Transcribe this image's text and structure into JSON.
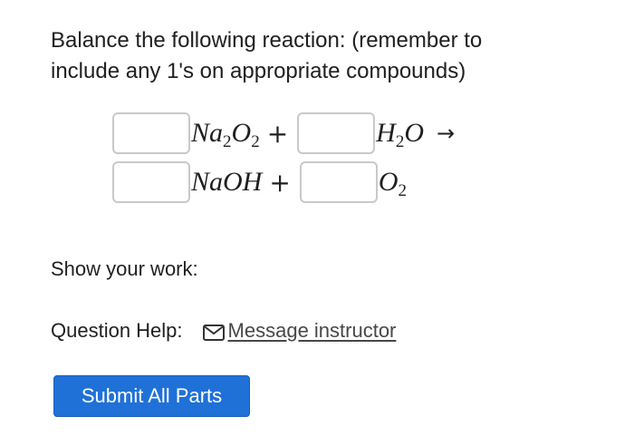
{
  "question": {
    "prompt_line1": "Balance the following reaction:  (remember to",
    "prompt_line2": "include any 1's on appropriate compounds)"
  },
  "equation": {
    "reactant1": {
      "base": "Na",
      "sub1": "2",
      "mid": "O",
      "sub2": "2"
    },
    "reactant2": {
      "base": "H",
      "sub1": "2",
      "mid": "O"
    },
    "product1": {
      "formula": "NaOH"
    },
    "product2": {
      "base": "O",
      "sub1": "2"
    },
    "plus": "+",
    "arrow": "→",
    "coefficients": [
      "",
      "",
      "",
      ""
    ]
  },
  "work": {
    "label": "Show your work:"
  },
  "help": {
    "label": "Question Help:",
    "icon": "envelope-icon",
    "link_text": "Message instructor"
  },
  "actions": {
    "submit_label": "Submit All Parts"
  },
  "colors": {
    "button_bg": "#1f71d8",
    "input_border": "#c9c9c9",
    "text": "#1f1f1f"
  }
}
